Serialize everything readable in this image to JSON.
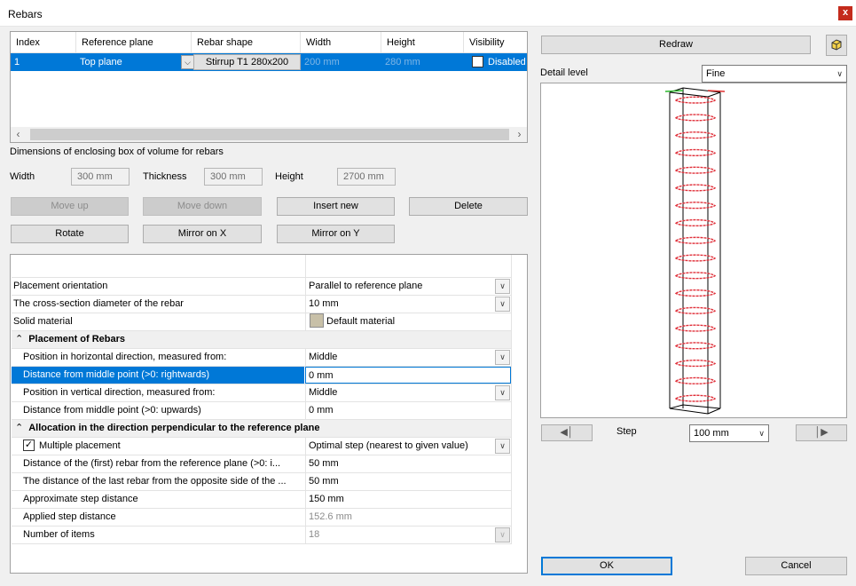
{
  "window": {
    "title": "Rebars",
    "close_glyph": "x"
  },
  "grid": {
    "headers": [
      "Index",
      "Reference plane",
      "Rebar shape",
      "Width",
      "Height",
      "Visibility"
    ],
    "row": {
      "index": "1",
      "reference_plane": "Top plane",
      "rebar_shape": "Stirrup T1 280x200",
      "width": "200 mm",
      "height": "280 mm",
      "visibility": "Disabled"
    }
  },
  "dimensions": {
    "heading": "Dimensions of enclosing box of volume for rebars",
    "width_label": "Width",
    "width_value": "300 mm",
    "thickness_label": "Thickness",
    "thickness_value": "300 mm",
    "height_label": "Height",
    "height_value": "2700 mm"
  },
  "buttons": {
    "move_up": "Move up",
    "move_down": "Move down",
    "insert_new": "Insert new",
    "delete": "Delete",
    "rotate": "Rotate",
    "mirror_x": "Mirror on X",
    "mirror_y": "Mirror on Y",
    "redraw": "Redraw",
    "ok": "OK",
    "cancel": "Cancel"
  },
  "properties": {
    "placement_orientation": {
      "name": "Placement orientation",
      "value": "Parallel to reference plane"
    },
    "cross_section": {
      "name": "The cross-section diameter of the rebar",
      "value": "10 mm"
    },
    "solid_material": {
      "name": "Solid material",
      "value": "Default material"
    },
    "cat_placement": "Placement of Rebars",
    "pos_horizontal": {
      "name": "Position in horizontal direction, measured from:",
      "value": "Middle"
    },
    "dist_middle_right": {
      "name": "Distance from middle point (>0: rightwards)",
      "value": "0 mm"
    },
    "pos_vertical": {
      "name": "Position in vertical direction, measured from:",
      "value": "Middle"
    },
    "dist_middle_up": {
      "name": "Distance from middle point (>0: upwards)",
      "value": "0 mm"
    },
    "cat_allocation": "Allocation in the direction perpendicular to the reference plane",
    "multiple_placement": {
      "name": "Multiple placement",
      "value": "Optimal step (nearest to given value)"
    },
    "first_rebar_dist": {
      "name": "Distance of the (first) rebar from the reference plane (>0: i...",
      "value": "50 mm"
    },
    "last_rebar_dist": {
      "name": "The distance of the last rebar from the opposite side of the ...",
      "value": "50 mm"
    },
    "approx_step": {
      "name": "Approximate step distance",
      "value": "150 mm"
    },
    "applied_step": {
      "name": "Applied step distance",
      "value": "152.6 mm"
    },
    "num_items": {
      "name": "Number of items",
      "value": "18"
    }
  },
  "preview": {
    "detail_label": "Detail level",
    "detail_value": "Fine",
    "step_label": "Step",
    "step_value": "100 mm",
    "rebar_count": 18,
    "rebar_color": "#e0303a"
  },
  "colors": {
    "selection": "#0078d7",
    "close": "#c42b1c"
  },
  "icons": {
    "view_cube": "cube-icon",
    "prev": "prev-arrow-icon",
    "next": "next-arrow-icon",
    "collapse": "collapse-chevron-icon"
  }
}
